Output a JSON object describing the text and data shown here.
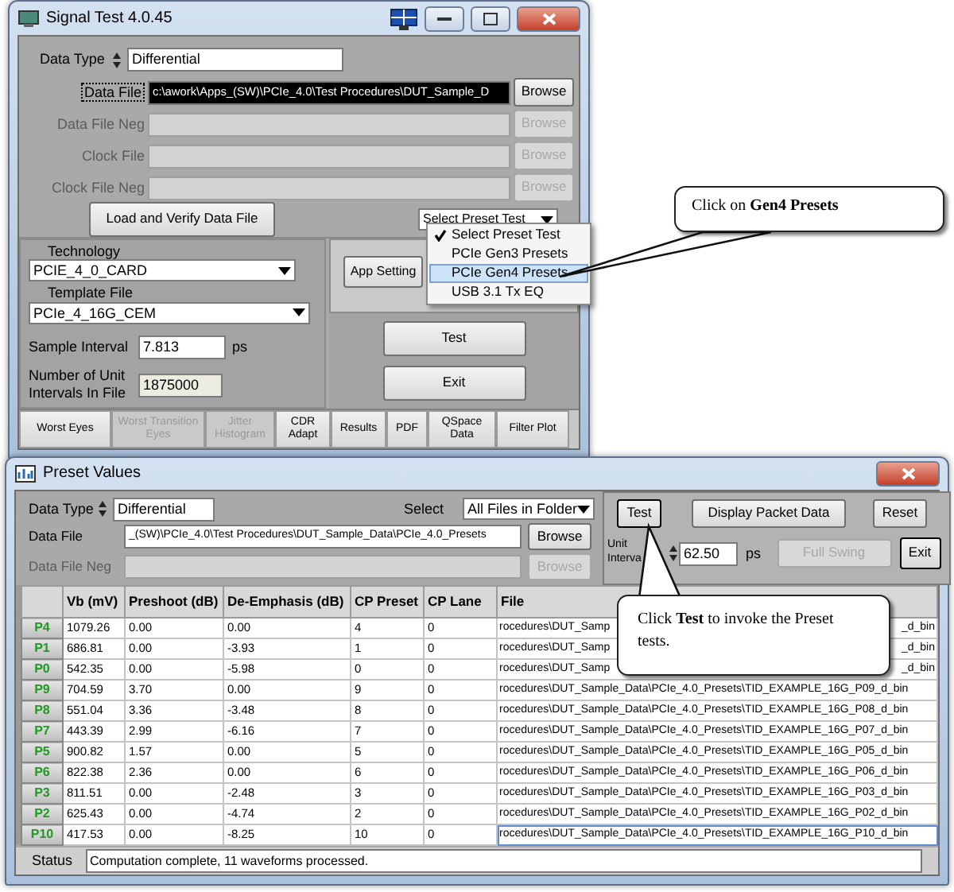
{
  "top_window": {
    "title": "Signal Test 4.0.45",
    "data_type": {
      "label": "Data Type",
      "value": "Differential"
    },
    "file_rows": [
      {
        "label": "Data File",
        "value": "c:\\awork\\Apps_(SW)\\PCIe_4.0\\Test Procedures\\DUT_Sample_D",
        "disabled": false,
        "focused": true,
        "button": "Browse"
      },
      {
        "label": "Data File Neg",
        "disabled": true,
        "focused": false,
        "button": "Browse"
      },
      {
        "label": "Clock File",
        "disabled": true,
        "focused": false,
        "button": "Browse"
      },
      {
        "label": "Clock File Neg",
        "disabled": true,
        "focused": false,
        "button": "Browse"
      }
    ],
    "load_button": "Load and Verify Data File",
    "preset_select": "Select Preset Test",
    "technology": {
      "label": "Technology",
      "value": "PCIE_4_0_CARD"
    },
    "template": {
      "label": "Template File",
      "value": "PCIe_4_16G_CEM"
    },
    "sample_interval": {
      "label": "Sample Interval",
      "value": "7.813",
      "unit": "ps"
    },
    "unit_intervals": {
      "label": "Number of Unit Intervals In File",
      "value": "1875000"
    },
    "app_settings_button": "App Setting",
    "test_button": "Test",
    "exit_button": "Exit",
    "tabs": [
      {
        "label": "Worst Eyes",
        "disabled": false
      },
      {
        "label": "Worst Transition Eyes",
        "disabled": true
      },
      {
        "label": "Jitter Histogram",
        "disabled": true
      },
      {
        "label": "CDR Adapt",
        "disabled": false
      },
      {
        "label": "Results",
        "disabled": false
      },
      {
        "label": "PDF",
        "disabled": false
      },
      {
        "label": "QSpace Data",
        "disabled": false
      },
      {
        "label": "Filter Plot",
        "disabled": false
      }
    ]
  },
  "preset_menu": [
    {
      "label": "Select Preset Test",
      "checked": true,
      "selected": false
    },
    {
      "label": "PCIe Gen3 Presets",
      "checked": false,
      "selected": false
    },
    {
      "label": "PCIe Gen4 Presets",
      "checked": false,
      "selected": true
    },
    {
      "label": "USB 3.1 Tx EQ",
      "checked": false,
      "selected": false
    }
  ],
  "bottom_window": {
    "title": "Preset Values",
    "data_type": {
      "label": "Data Type",
      "value": "Differential"
    },
    "select": {
      "label": "Select",
      "value": "All Files in Folder"
    },
    "file_rows": [
      {
        "label": "Data File",
        "value": "_(SW)\\PCIe_4.0\\Test Procedures\\DUT_Sample_Data\\PCIe_4.0_Presets",
        "disabled": false,
        "button": "Browse"
      },
      {
        "label": "Data File Neg",
        "disabled": true,
        "button": "Browse"
      }
    ],
    "test_button": "Test",
    "display_button": "Display Packet Data",
    "reset_button": "Reset",
    "unit_interval": {
      "label": "Unit Interva",
      "value": "62.50",
      "unit": "ps"
    },
    "full_swing_button": {
      "label": "Full Swing",
      "disabled": true
    },
    "exit_button": "Exit",
    "table": {
      "columns": [
        "Vb (mV)",
        "Preshoot (dB)",
        "De-Emphasis (dB)",
        "CP Preset",
        "CP Lane",
        "File"
      ],
      "rows": [
        {
          "preset": "P4",
          "cells": [
            "1079.26",
            "0.00",
            "0.00",
            "4",
            "0"
          ],
          "file": "rocedures\\DUT_Samp",
          "file_tail": "_d_bin",
          "selected": false
        },
        {
          "preset": "P1",
          "cells": [
            "686.81",
            "0.00",
            "-3.93",
            "1",
            "0"
          ],
          "file": "rocedures\\DUT_Samp",
          "file_tail": "_d_bin",
          "selected": false
        },
        {
          "preset": "P0",
          "cells": [
            "542.35",
            "0.00",
            "-5.98",
            "0",
            "0"
          ],
          "file": "rocedures\\DUT_Samp",
          "file_tail": "_d_bin",
          "selected": false
        },
        {
          "preset": "P9",
          "cells": [
            "704.59",
            "3.70",
            "0.00",
            "9",
            "0"
          ],
          "file": "rocedures\\DUT_Sample_Data\\PCIe_4.0_Presets\\TID_EXAMPLE_16G_P09_d_bin",
          "selected": false
        },
        {
          "preset": "P8",
          "cells": [
            "551.04",
            "3.36",
            "-3.48",
            "8",
            "0"
          ],
          "file": "rocedures\\DUT_Sample_Data\\PCIe_4.0_Presets\\TID_EXAMPLE_16G_P08_d_bin",
          "selected": false
        },
        {
          "preset": "P7",
          "cells": [
            "443.39",
            "2.99",
            "-6.16",
            "7",
            "0"
          ],
          "file": "rocedures\\DUT_Sample_Data\\PCIe_4.0_Presets\\TID_EXAMPLE_16G_P07_d_bin",
          "selected": false
        },
        {
          "preset": "P5",
          "cells": [
            "900.82",
            "1.57",
            "0.00",
            "5",
            "0"
          ],
          "file": "rocedures\\DUT_Sample_Data\\PCIe_4.0_Presets\\TID_EXAMPLE_16G_P05_d_bin",
          "selected": false
        },
        {
          "preset": "P6",
          "cells": [
            "822.38",
            "2.36",
            "0.00",
            "6",
            "0"
          ],
          "file": "rocedures\\DUT_Sample_Data\\PCIe_4.0_Presets\\TID_EXAMPLE_16G_P06_d_bin",
          "selected": false
        },
        {
          "preset": "P3",
          "cells": [
            "811.51",
            "0.00",
            "-2.48",
            "3",
            "0"
          ],
          "file": "rocedures\\DUT_Sample_Data\\PCIe_4.0_Presets\\TID_EXAMPLE_16G_P03_d_bin",
          "selected": false
        },
        {
          "preset": "P2",
          "cells": [
            "625.43",
            "0.00",
            "-4.74",
            "2",
            "0"
          ],
          "file": "rocedures\\DUT_Sample_Data\\PCIe_4.0_Presets\\TID_EXAMPLE_16G_P02_d_bin",
          "selected": false
        },
        {
          "preset": "P10",
          "cells": [
            "417.53",
            "0.00",
            "-8.25",
            "10",
            "0"
          ],
          "file": "rocedures\\DUT_Sample_Data\\PCIe_4.0_Presets\\TID_EXAMPLE_16G_P10_d_bin",
          "selected": true
        }
      ]
    },
    "status": {
      "label": "Status",
      "value": "Computation complete, 11 waveforms processed."
    }
  },
  "callouts": [
    {
      "text": "Click on **Gen4 Presets**"
    },
    {
      "text": "Click **Test** to invoke the Preset tests."
    }
  ]
}
